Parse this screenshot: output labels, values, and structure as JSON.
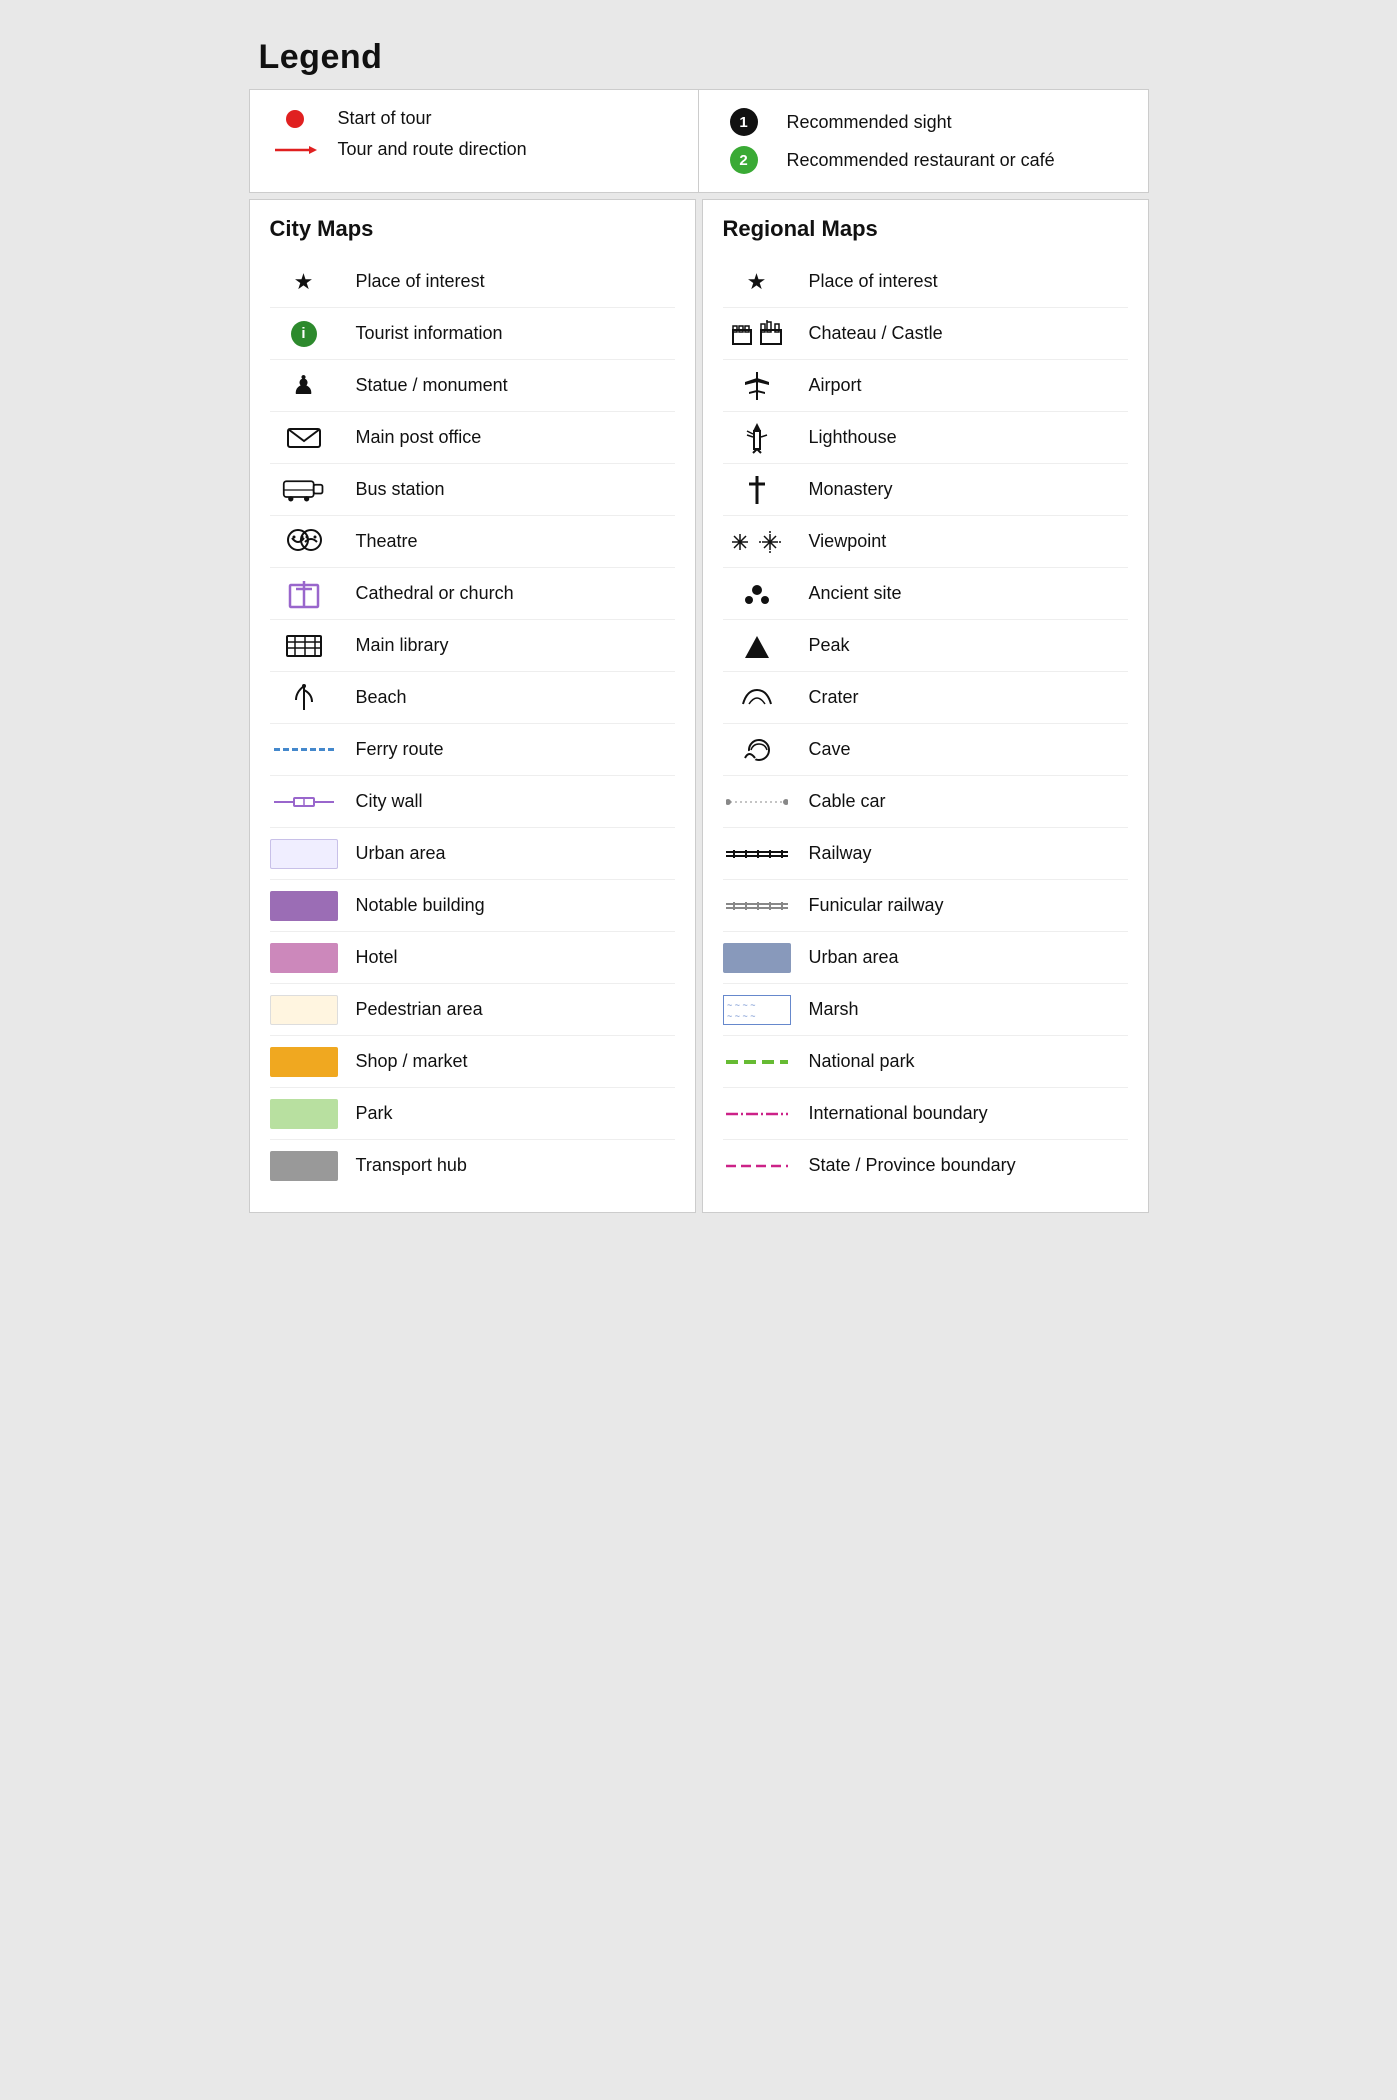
{
  "title": "Legend",
  "top": {
    "left": {
      "rows": [
        {
          "icon": "dot-red",
          "label": "Start of tour"
        },
        {
          "icon": "arrow-red",
          "label": "Tour and route direction"
        }
      ]
    },
    "right": {
      "rows": [
        {
          "icon": "num-1-black",
          "label": "Recommended sight"
        },
        {
          "icon": "num-2-green",
          "label": "Recommended restaurant or café"
        }
      ]
    }
  },
  "city_maps": {
    "title": "City Maps",
    "items": [
      {
        "icon": "star",
        "label": "Place of interest"
      },
      {
        "icon": "info",
        "label": "Tourist information"
      },
      {
        "icon": "statue",
        "label": "Statue / monument"
      },
      {
        "icon": "mail",
        "label": "Main post office"
      },
      {
        "icon": "bus",
        "label": "Bus station"
      },
      {
        "icon": "theatre",
        "label": "Theatre"
      },
      {
        "icon": "church",
        "label": "Cathedral or church"
      },
      {
        "icon": "library",
        "label": "Main library"
      },
      {
        "icon": "beach",
        "label": "Beach"
      },
      {
        "icon": "ferry",
        "label": "Ferry route"
      },
      {
        "icon": "citywall",
        "label": "City wall"
      },
      {
        "icon": "swatch-urban",
        "label": "Urban area"
      },
      {
        "icon": "swatch-notable",
        "label": "Notable building"
      },
      {
        "icon": "swatch-hotel",
        "label": "Hotel"
      },
      {
        "icon": "swatch-pedestrian",
        "label": "Pedestrian area"
      },
      {
        "icon": "swatch-shop",
        "label": "Shop / market"
      },
      {
        "icon": "swatch-park",
        "label": "Park"
      },
      {
        "icon": "swatch-transport",
        "label": "Transport hub"
      }
    ]
  },
  "regional_maps": {
    "title": "Regional Maps",
    "items": [
      {
        "icon": "star",
        "label": "Place of interest"
      },
      {
        "icon": "chateau",
        "label": "Chateau / Castle"
      },
      {
        "icon": "airport",
        "label": "Airport"
      },
      {
        "icon": "lighthouse",
        "label": "Lighthouse"
      },
      {
        "icon": "monastery",
        "label": "Monastery"
      },
      {
        "icon": "viewpoint",
        "label": "Viewpoint"
      },
      {
        "icon": "ancient",
        "label": "Ancient site"
      },
      {
        "icon": "peak",
        "label": "Peak"
      },
      {
        "icon": "crater",
        "label": "Crater"
      },
      {
        "icon": "cave",
        "label": "Cave"
      },
      {
        "icon": "cablecar",
        "label": "Cable car"
      },
      {
        "icon": "railway",
        "label": "Railway"
      },
      {
        "icon": "funicular",
        "label": "Funicular railway"
      },
      {
        "icon": "swatch-urban-regional",
        "label": "Urban area"
      },
      {
        "icon": "swatch-marsh",
        "label": "Marsh"
      },
      {
        "icon": "national-park",
        "label": "National park"
      },
      {
        "icon": "intl-boundary",
        "label": "International boundary"
      },
      {
        "icon": "state-boundary",
        "label": "State / Province boundary"
      }
    ]
  }
}
